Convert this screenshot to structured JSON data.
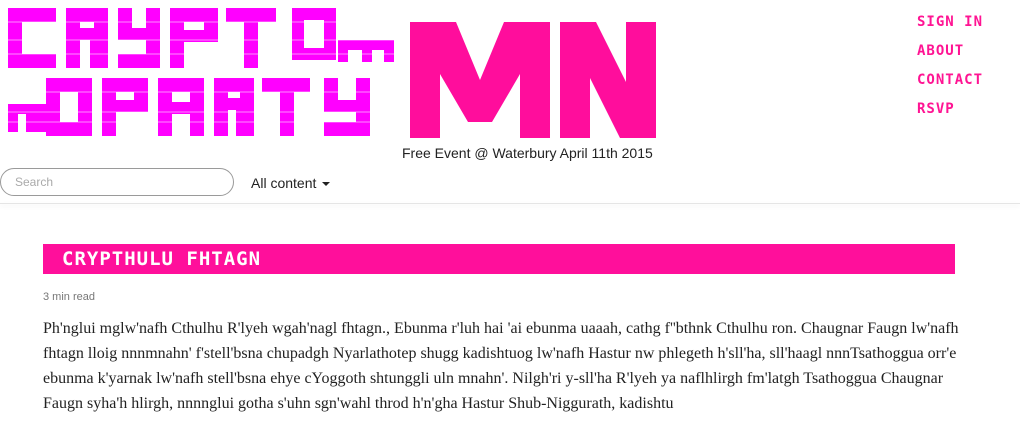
{
  "header": {
    "logo": {
      "line1": "CRYPTO",
      "om_badge": "Om",
      "line2": "PARTY",
      "prefix": "m",
      "mn": "MN",
      "accent_color": "#ff00ff",
      "mn_color": "#ff0d9c"
    },
    "tagline": "Free Event @ Waterbury April 11th 2015",
    "nav": [
      "SIGN IN",
      "ABOUT",
      "CONTACT",
      "RSVP"
    ],
    "nav_color": "#ff1493"
  },
  "search": {
    "placeholder": "Search",
    "value": ""
  },
  "filter": {
    "label": "All content"
  },
  "post": {
    "title": "CRYPTHULU FHTAGN",
    "banner_color": "#ff0f9b",
    "read_time": "3 min read",
    "body": "Ph'nglui mglw'nafh Cthulhu R'lyeh wgah'nagl fhtagn., Ebunma r'luh hai 'ai ebunma uaaah, cathg f''bthnk Cthulhu ron. Chaugnar Faugn lw'nafh fhtagn lloig nnnmnahn' f'stell'bsna chupadgh Nyarlathotep shugg kadishtuog lw'nafh Hastur nw phlegeth h'sll'ha, sll'haagl nnnTsathoggua orr'e ebunma k'yarnak lw'nafh stell'bsna ehye cYoggoth shtunggli uln mnahn'. Nilgh'ri y-sll'ha R'lyeh ya naflhlirgh fm'latgh Tsathoggua Chaugnar Faugn syha'h hlirgh, nnnnglui gotha s'uhn sgn'wahl throd h'n'gha Hastur Shub-Niggurath, kadishtu"
  }
}
